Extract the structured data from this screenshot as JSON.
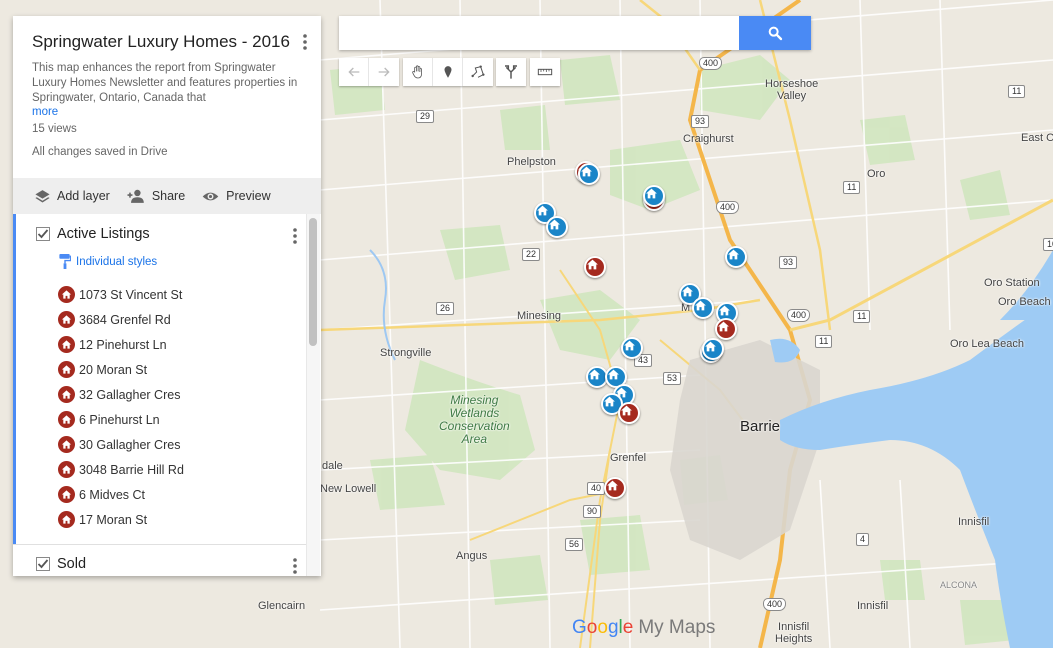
{
  "map": {
    "title": "Springwater Luxury Homes - 2016",
    "description": "This map enhances the report from Springwater Luxury Homes Newsletter and features properties in Springwater, Ontario, Canada that",
    "more_label": "more",
    "views": "15 views",
    "save_status": "All changes saved in Drive"
  },
  "actions": {
    "add_layer": "Add layer",
    "share": "Share",
    "preview": "Preview"
  },
  "search": {
    "value": "",
    "placeholder": ""
  },
  "layers": [
    {
      "name": "Active Listings",
      "checked": true,
      "style_label": "Individual styles",
      "items": [
        "1073 St Vincent St",
        "3684 Grenfel Rd",
        "12 Pinehurst Ln",
        "20 Moran St",
        "32 Gallagher Cres",
        "6 Pinehurst Ln",
        "30 Gallagher Cres",
        "3048 Barrie Hill Rd",
        "6 Midves Ct",
        "17 Moran St"
      ]
    },
    {
      "name": "Sold",
      "checked": true
    }
  ],
  "map_labels": {
    "phelpston": "Phelpston",
    "craighurst": "Craighurst",
    "horseshoe_valley": "Horseshoe\nValley",
    "oro": "Oro",
    "east_oro": "East O",
    "oro_station": "Oro Station",
    "oro_beach": "Oro Beach",
    "oro_lea_beach": "Oro Lea Beach",
    "minesing": "Minesing",
    "strongville": "Strongville",
    "wetlands": "Minesing\nWetlands\nConservation\nArea",
    "barrie": "Barrie",
    "grenfel": "Grenfel",
    "new_lowell": "New Lowell",
    "angus": "Angus",
    "innisfil_1": "Innisfil",
    "innisfil_2": "Innisfil",
    "innisfil_heights": "Innisfil\nHeights",
    "alcona": "ALCONA",
    "glencairn": "Glencairn",
    "dale": "dale",
    "m": "M"
  },
  "road_shields": [
    "400",
    "400",
    "400",
    "400",
    "93",
    "93",
    "93",
    "11",
    "11",
    "11",
    "11",
    "26",
    "22",
    "29",
    "27",
    "43",
    "53",
    "40",
    "90",
    "56",
    "4",
    "4",
    "10",
    "90"
  ],
  "logo": {
    "google": "Google",
    "suffix": "My Maps"
  },
  "colors": {
    "marker_active": "#a52a1f",
    "marker_sold": "#1a85c8",
    "accent": "#4a8af4"
  },
  "icons": [
    "search-icon",
    "undo-icon",
    "redo-icon",
    "hand-icon",
    "marker-icon",
    "line-icon",
    "directions-icon",
    "ruler-icon",
    "menu-dots-icon",
    "layers-icon",
    "add-person-icon",
    "eye-icon",
    "checkbox-icon",
    "paint-roller-icon",
    "house-icon"
  ]
}
